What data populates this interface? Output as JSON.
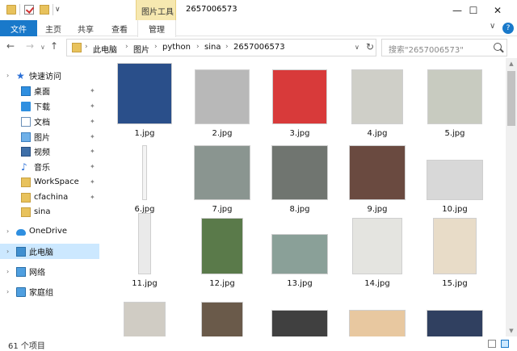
{
  "titlebar": {
    "context_tool_label": "图片工具",
    "title": "2657006573",
    "min": "—",
    "max": "☐",
    "close": "✕"
  },
  "ribbon": {
    "tabs": [
      "文件",
      "主页",
      "共享",
      "查看",
      "管理"
    ],
    "chevron": "∨",
    "help": "?"
  },
  "nav": {
    "back": "←",
    "forward": "→",
    "dropdown": "∨",
    "up": "↑",
    "breadcrumb": [
      "此电脑",
      "图片",
      "python",
      "sina",
      "2657006573"
    ],
    "separator": "›",
    "addr_dropdown": "∨",
    "refresh": "↻",
    "search_placeholder": "搜索\"2657006573\""
  },
  "sidebar": {
    "items": [
      {
        "label": "快速访问",
        "icon": "star-icon",
        "pinned": false
      },
      {
        "label": "桌面",
        "icon": "desktop-icon",
        "pinned": true
      },
      {
        "label": "下载",
        "icon": "download-icon",
        "pinned": true
      },
      {
        "label": "文档",
        "icon": "document-icon",
        "pinned": true
      },
      {
        "label": "图片",
        "icon": "pictures-icon",
        "pinned": true
      },
      {
        "label": "视频",
        "icon": "video-icon",
        "pinned": true
      },
      {
        "label": "音乐",
        "icon": "music-icon",
        "pinned": true
      },
      {
        "label": "WorkSpace",
        "icon": "folder-icon",
        "pinned": true
      },
      {
        "label": "cfachina",
        "icon": "folder-icon",
        "pinned": true
      },
      {
        "label": "sina",
        "icon": "folder-icon",
        "pinned": false
      },
      {
        "label": "OneDrive",
        "icon": "cloud-icon",
        "pinned": false
      },
      {
        "label": "此电脑",
        "icon": "pc-icon",
        "pinned": false,
        "selected": true
      },
      {
        "label": "网络",
        "icon": "network-icon",
        "pinned": false
      },
      {
        "label": "家庭组",
        "icon": "homegroup-icon",
        "pinned": false
      }
    ],
    "expand_arrow": "›",
    "pin": "📌"
  },
  "files": [
    {
      "name": "1.jpg",
      "color": "#2a4f8a"
    },
    {
      "name": "2.jpg",
      "color": "#b8b8b8"
    },
    {
      "name": "3.jpg",
      "color": "#d83a3a"
    },
    {
      "name": "4.jpg",
      "color": "#cfcfc8"
    },
    {
      "name": "5.jpg",
      "color": "#c8cbc0"
    },
    {
      "name": "6.jpg",
      "color": "#f4f4f4"
    },
    {
      "name": "7.jpg",
      "color": "#8a9590"
    },
    {
      "name": "8.jpg",
      "color": "#707570"
    },
    {
      "name": "9.jpg",
      "color": "#6a4a40"
    },
    {
      "name": "10.jpg",
      "color": "#d8d8d8"
    },
    {
      "name": "11.jpg",
      "color": "#eaeaea"
    },
    {
      "name": "12.jpg",
      "color": "#5a7a4a"
    },
    {
      "name": "13.jpg",
      "color": "#8aa098"
    },
    {
      "name": "14.jpg",
      "color": "#e4e4e0"
    },
    {
      "name": "15.jpg",
      "color": "#e8dcc8"
    },
    {
      "name": "",
      "color": "#d0ccc4"
    },
    {
      "name": "",
      "color": "#6a5a4a"
    },
    {
      "name": "",
      "color": "#404040"
    },
    {
      "name": "",
      "color": "#e8c8a0"
    },
    {
      "name": "",
      "color": "#304060"
    }
  ],
  "status": {
    "count": "61 个项目"
  }
}
